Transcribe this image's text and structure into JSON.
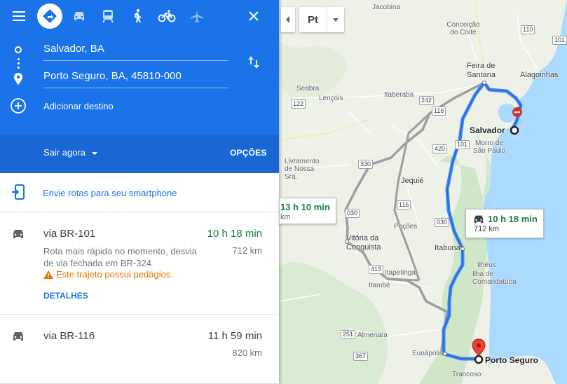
{
  "modes": [
    {
      "name": "directions",
      "icon": "directions-icon",
      "active": true
    },
    {
      "name": "car",
      "icon": "car-icon",
      "active": false
    },
    {
      "name": "transit",
      "icon": "train-icon",
      "active": false
    },
    {
      "name": "walk",
      "icon": "walk-icon",
      "active": false
    },
    {
      "name": "bike",
      "icon": "bike-icon",
      "active": false
    },
    {
      "name": "flight",
      "icon": "flight-icon",
      "active": false
    }
  ],
  "origin": "Salvador, BA",
  "destination": "Porto Seguro, BA, 45810-000",
  "add_destination": "Adicionar destino",
  "depart_label": "Sair agora",
  "options_label": "OPÇÕES",
  "send_to_phone": "Envie rotas para seu smartphone",
  "routes": [
    {
      "name": "via BR-101",
      "time": "10 h 18 min",
      "distance": "712 km",
      "description": "Rota mais rápida no momento, desvia de via fechada em BR-324",
      "warning": "Este trajeto possui pedágios.",
      "details": "DETALHES",
      "time_color": "#188038"
    },
    {
      "name": "via BR-116",
      "time": "11 h 59 min",
      "distance": "820 km",
      "time_color": "#3c4043"
    }
  ],
  "map": {
    "layer_button": "Pt",
    "callout_main": {
      "time": "10 h 18 min",
      "distance": "712 km"
    },
    "callout_alt": {
      "time": "13 h 10 min",
      "distance": "km"
    },
    "places": {
      "jacobina": "Jacobina",
      "conceicao": "Conceição do Coité",
      "feira": "Feira de Santana",
      "alagoinhas": "Alagoinhas",
      "seabra": "Seabra",
      "lencois": "Lençóis",
      "itaberaba": "Itaberaba",
      "salvador": "Salvador",
      "morro": "Morro de São Paulo",
      "livramento": "Livramento de Nossa Sra.",
      "jequie": "Jequié",
      "pocoes": "Poções",
      "vitoria": "Vitória da Conquista",
      "itabuna": "Itabuna",
      "ilheus": "Ilhéus",
      "comandatuba": "Ilha de Comandatuba",
      "itapetinga": "Itapetinga",
      "itambe": "Itambé",
      "almenara": "Almenara",
      "eunapolis": "Eunápolis",
      "porto": "Porto Seguro",
      "trancoso": "Trancoso"
    },
    "shields": {
      "s110": "110",
      "s101a": "101",
      "s122": "122",
      "s242": "242",
      "s116a": "116",
      "s420": "420",
      "s101b": "101",
      "s330": "330",
      "s030a": "030",
      "s116b": "116",
      "s030b": "030",
      "s415": "415",
      "s251": "251",
      "s367": "367"
    }
  }
}
